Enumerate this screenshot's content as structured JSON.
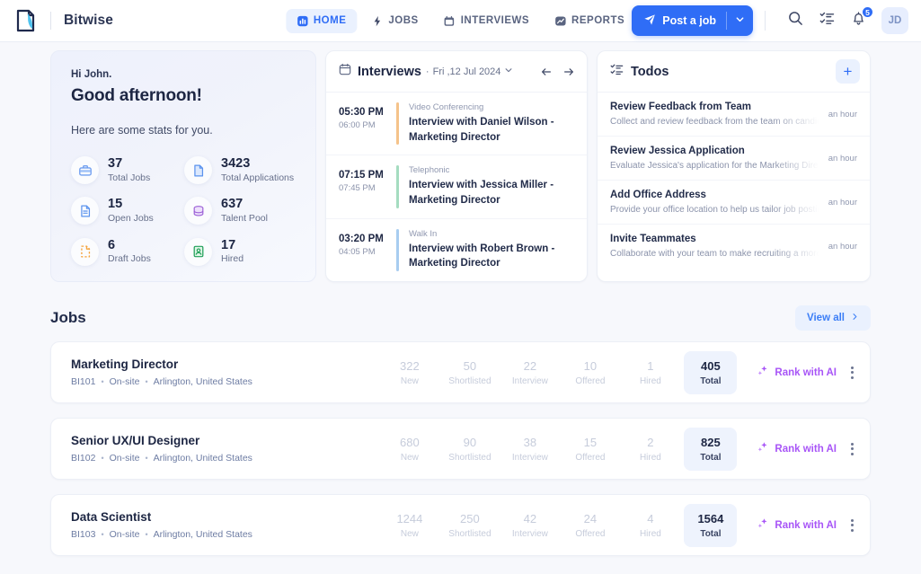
{
  "header": {
    "brand": "Bitwise",
    "logo_icon": "document-brush-logo",
    "nav": [
      {
        "label": "HOME",
        "icon": "dashboard-icon",
        "active": true
      },
      {
        "label": "JOBS",
        "icon": "bolt-icon",
        "active": false
      },
      {
        "label": "INTERVIEWS",
        "icon": "calendar-icon",
        "active": false
      },
      {
        "label": "REPORTS",
        "icon": "chart-icon",
        "active": false
      }
    ],
    "post_job_label": "Post a job",
    "post_job_icon": "send-icon",
    "post_job_caret_icon": "chevron-down-icon",
    "search_icon": "search-icon",
    "tasks_icon": "task-list-icon",
    "bell_icon": "bell-icon",
    "notification_count": "5",
    "avatar_initials": "JD",
    "accent_blue": "#2f6df6"
  },
  "greeting": {
    "hi": "Hi John.",
    "headline": "Good afternoon!",
    "subtitle": "Here are some stats for you.",
    "stats": [
      {
        "value": "37",
        "label": "Total Jobs",
        "icon": "briefcase-icon"
      },
      {
        "value": "3423",
        "label": "Total Applications",
        "icon": "document-icon"
      },
      {
        "value": "15",
        "label": "Open Jobs",
        "icon": "file-text-icon"
      },
      {
        "value": "637",
        "label": "Talent Pool",
        "icon": "database-icon"
      },
      {
        "value": "6",
        "label": "Draft Jobs",
        "icon": "draft-file-icon"
      },
      {
        "value": "17",
        "label": "Hired",
        "icon": "id-badge-icon"
      }
    ]
  },
  "interviews": {
    "title": "Interviews",
    "separator": "·",
    "date": "Fri ,12 Jul 2024",
    "calendar_icon": "calendar-icon",
    "date_caret_icon": "chevron-down-icon",
    "prev_icon": "arrow-left-icon",
    "next_icon": "arrow-right-icon",
    "items": [
      {
        "start": "05:30 PM",
        "end": "06:00 PM",
        "kind": "Video Conferencing",
        "name": "Interview with Daniel Wilson - Marketing Director",
        "color": "#f5c38a"
      },
      {
        "start": "07:15 PM",
        "end": "07:45 PM",
        "kind": "Telephonic",
        "name": "Interview with Jessica Miller - Marketing Director",
        "color": "#a5dcc0"
      },
      {
        "start": "03:20 PM",
        "end": "04:05 PM",
        "kind": "Walk In",
        "name": "Interview with Robert Brown - Marketing Director",
        "color": "#a8cdf0"
      }
    ]
  },
  "todos": {
    "title": "Todos",
    "icon": "task-list-icon",
    "add_label": "+",
    "items": [
      {
        "name": "Review Feedback from Team",
        "desc": "Collect and review feedback from the team on candidates",
        "time": "an hour"
      },
      {
        "name": "Review Jessica Application",
        "desc": "Evaluate Jessica's application for the Marketing Director",
        "time": "an hour"
      },
      {
        "name": "Add Office Address",
        "desc": "Provide your office location to help us tailor job postings",
        "time": "an hour"
      },
      {
        "name": "Invite Teammates",
        "desc": "Collaborate with your team to make recruiting a more efficient",
        "time": "an hour"
      }
    ]
  },
  "jobs": {
    "section_title": "Jobs",
    "view_all_label": "View all",
    "view_all_icon": "chevron-right-icon",
    "rank_label": "Rank with AI",
    "rank_icon": "sparkle-icon",
    "kebab_icon": "more-vertical-icon",
    "metric_labels": [
      "New",
      "Shortlisted",
      "Interview",
      "Offered",
      "Hired"
    ],
    "total_label": "Total",
    "rows": [
      {
        "title": "Marketing Director",
        "code": "BI101",
        "worktype": "On-site",
        "location": "Arlington, United States",
        "metrics": [
          "322",
          "50",
          "22",
          "10",
          "1"
        ],
        "total": "405"
      },
      {
        "title": "Senior UX/UI Designer",
        "code": "BI102",
        "worktype": "On-site",
        "location": "Arlington, United States",
        "metrics": [
          "680",
          "90",
          "38",
          "15",
          "2"
        ],
        "total": "825"
      },
      {
        "title": "Data Scientist",
        "code": "BI103",
        "worktype": "On-site",
        "location": "Arlington, United States",
        "metrics": [
          "1244",
          "250",
          "42",
          "24",
          "4"
        ],
        "total": "1564"
      }
    ]
  }
}
